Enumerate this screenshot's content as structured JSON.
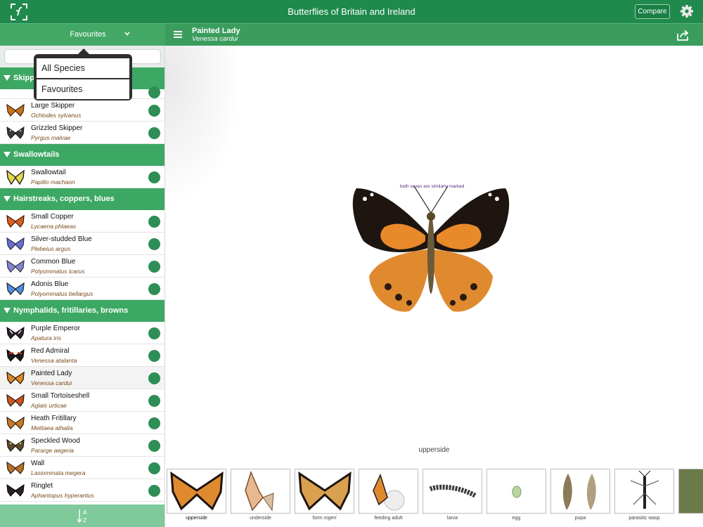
{
  "app": {
    "title": "Butterflies of Britain and Ireland",
    "compare_label": "Compare"
  },
  "filter": {
    "selected": "Favourites",
    "options": [
      "All Species",
      "Favourites"
    ]
  },
  "current": {
    "common_name": "Painted Lady",
    "scientific_name": "Venessa cardui",
    "note": "both sexes are similarly marked",
    "view_label": "upperside"
  },
  "sections": {
    "skippers": "Skipp",
    "swallowtails": "Swallowtails",
    "hairstreaks": "Hairstreaks, coppers, blues",
    "nymphalids": "Nymphalids, fritillaries, browns"
  },
  "species": [
    {
      "common": "Large Skipper",
      "sci": "Ochlodes sylvanus"
    },
    {
      "common": "Grizzled Skipper",
      "sci": "Pyrgus malvae"
    },
    {
      "common": "Swallowtail",
      "sci": "Papilio machaon"
    },
    {
      "common": "Small Copper",
      "sci": "Lycaena phlaeas"
    },
    {
      "common": "Silver-studded Blue",
      "sci": "Plebeius argus"
    },
    {
      "common": "Common Blue",
      "sci": "Polyommatus icarus"
    },
    {
      "common": "Adonis Blue",
      "sci": "Polyommatus bellargus"
    },
    {
      "common": "Purple Emperor",
      "sci": "Apatura iris"
    },
    {
      "common": "Red Admiral",
      "sci": "Venessa atalanta"
    },
    {
      "common": "Painted Lady",
      "sci": "Venessa cardui"
    },
    {
      "common": "Small Tortoiseshell",
      "sci": "Aglais urticae"
    },
    {
      "common": "Heath Fritillary",
      "sci": "Melitaea athalia"
    },
    {
      "common": "Speckled Wood",
      "sci": "Pararge aegeria"
    },
    {
      "common": "Wall",
      "sci": "Lasiommata megera"
    },
    {
      "common": "Ringlet",
      "sci": "Aphantopus hyperantus"
    }
  ],
  "thumbnails": {
    "upperside": "upperside",
    "underside": "underside",
    "form_prefix": "form",
    "form_name": "rogeri",
    "feeding": "feeding adult",
    "larva": "larva",
    "egg": "egg",
    "pupa": "pupa",
    "wasp": "parasitic wasp"
  },
  "colors": {
    "header": "#1f8a4c",
    "section": "#3da863",
    "dot": "#2f8e55"
  }
}
